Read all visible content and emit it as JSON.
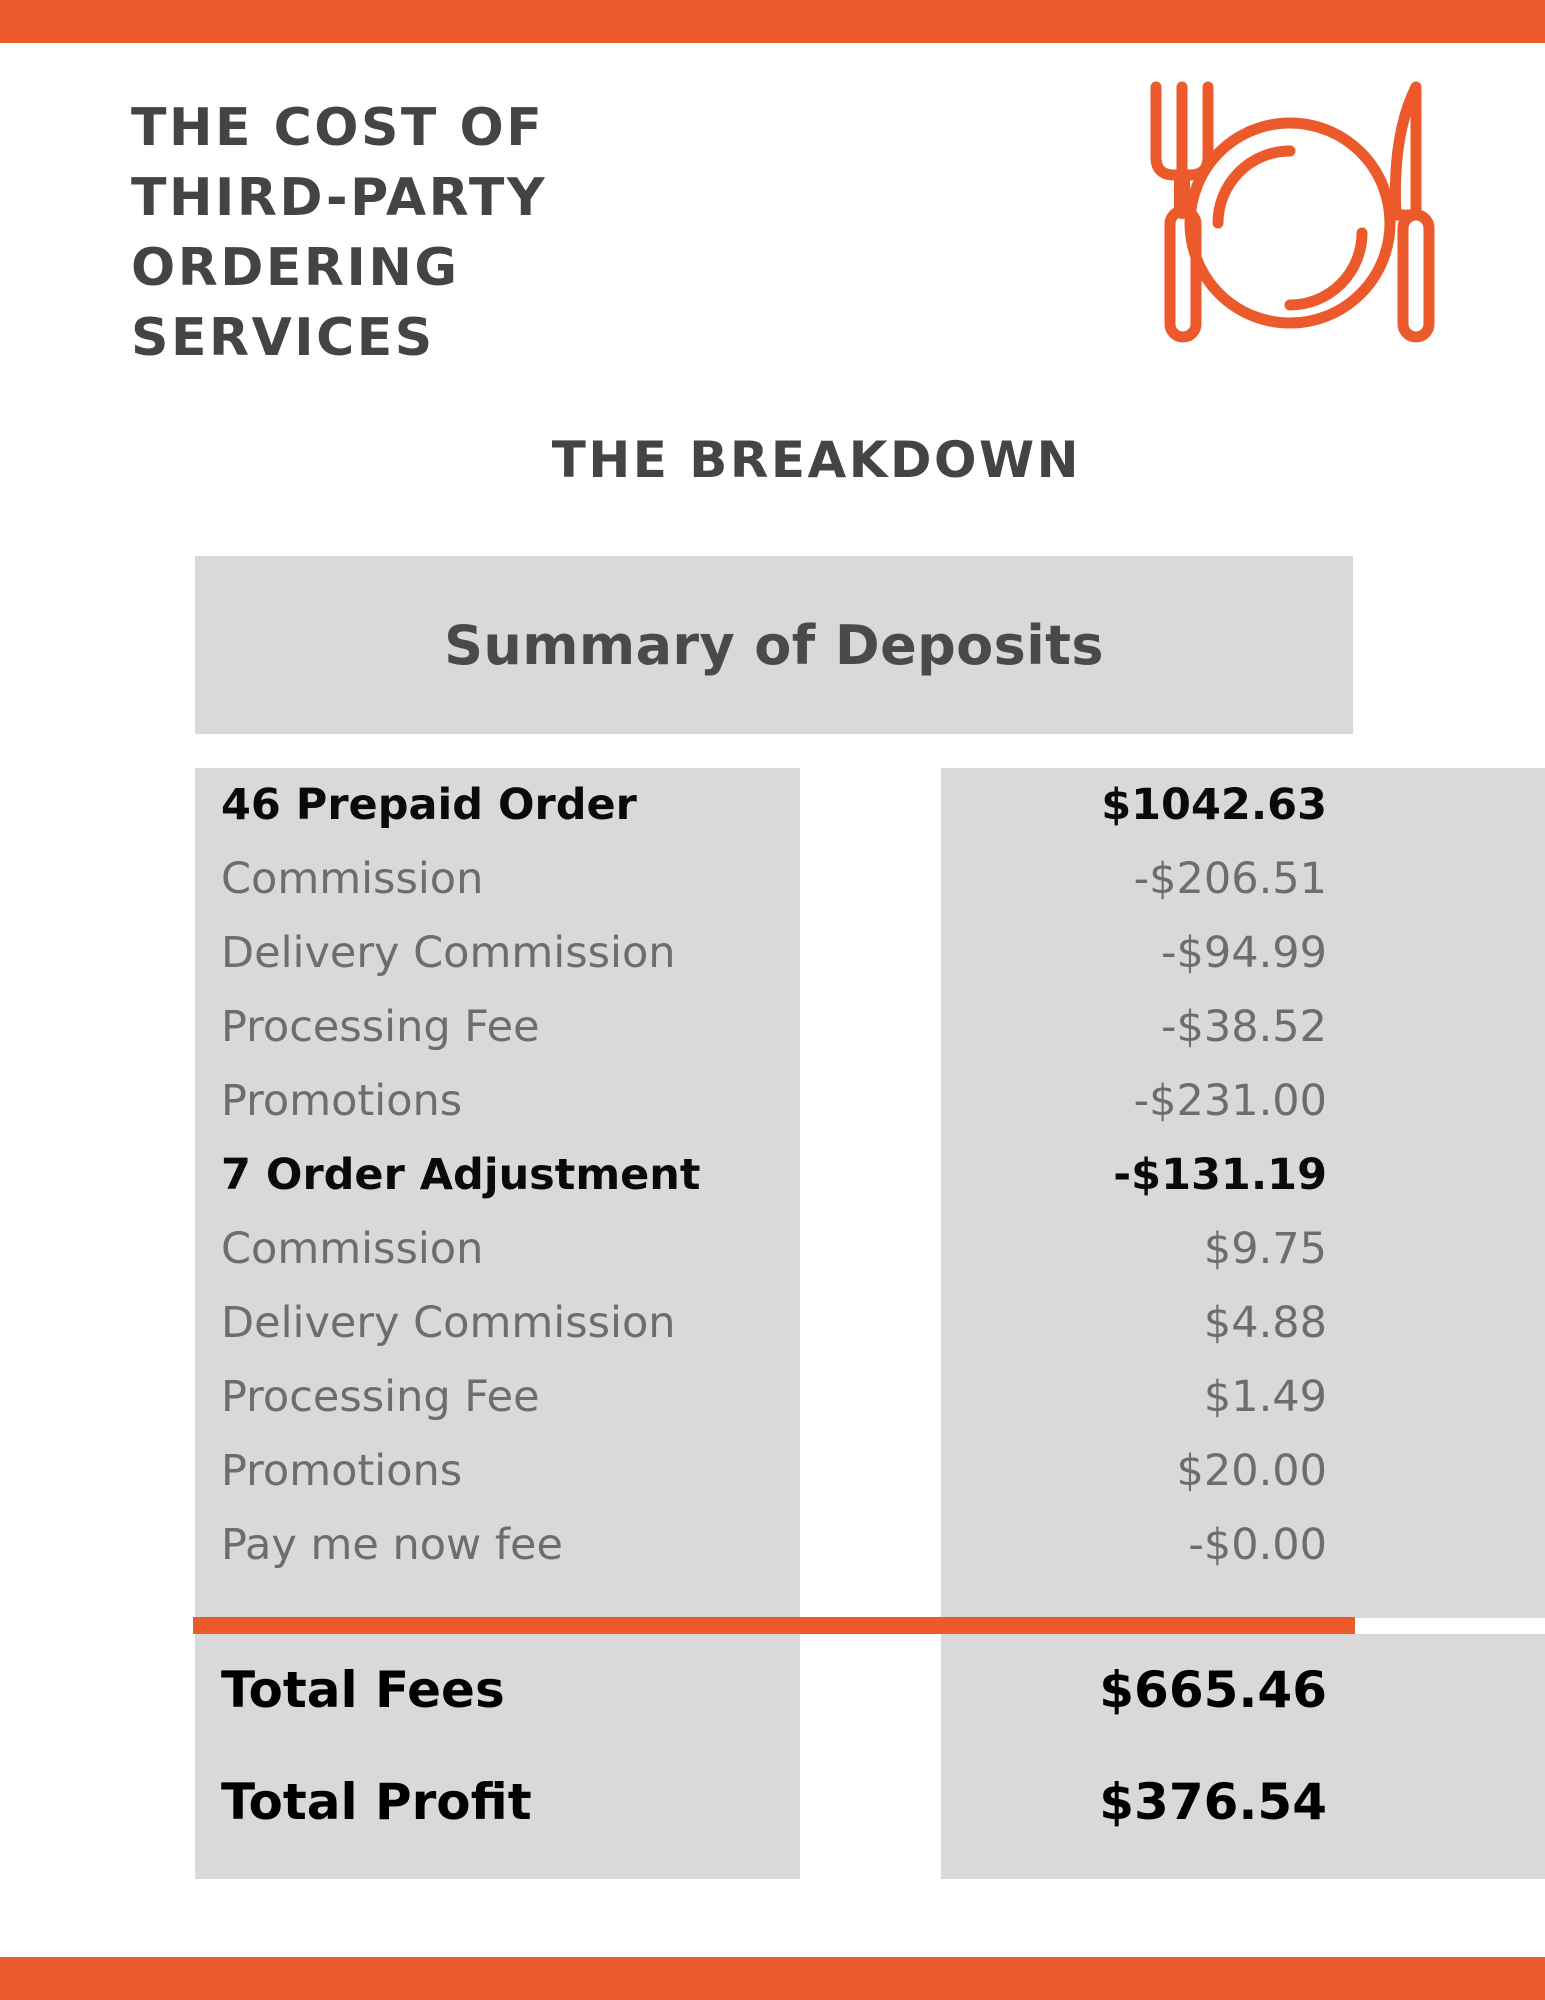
{
  "colors": {
    "accent": "#EC5A2B",
    "panel_gray": "#D9D9D9",
    "title_gray": "#444444",
    "detail_gray": "#6D6D6D"
  },
  "header": {
    "title_lines": [
      "THE COST OF",
      "THIRD-PARTY",
      "ORDERING",
      "SERVICES"
    ],
    "subtitle": "THE BREAKDOWN",
    "icon": "fork-plate-knife-icon"
  },
  "summary": {
    "band_title": "Summary of Deposits"
  },
  "table": {
    "rows": [
      {
        "type": "head",
        "label": "46 Prepaid Order",
        "value": "$1042.63"
      },
      {
        "type": "detail",
        "label": "Commission",
        "value": "-$206.51"
      },
      {
        "type": "detail",
        "label": "Delivery Commission",
        "value": "-$94.99"
      },
      {
        "type": "detail",
        "label": "Processing Fee",
        "value": "-$38.52"
      },
      {
        "type": "detail",
        "label": "Promotions",
        "value": "-$231.00"
      },
      {
        "type": "head",
        "label": "7 Order Adjustment",
        "value": "-$131.19"
      },
      {
        "type": "detail",
        "label": "Commission",
        "value": "$9.75"
      },
      {
        "type": "detail",
        "label": "Delivery Commission",
        "value": "$4.88"
      },
      {
        "type": "detail",
        "label": "Processing Fee",
        "value": "$1.49"
      },
      {
        "type": "detail",
        "label": "Promotions",
        "value": "$20.00"
      },
      {
        "type": "detail",
        "label": "Pay me now fee",
        "value": "-$0.00"
      }
    ],
    "totals": [
      {
        "label": "Total Fees",
        "value": "$665.46"
      },
      {
        "label": "Total Profit",
        "value": "$376.54"
      }
    ]
  }
}
